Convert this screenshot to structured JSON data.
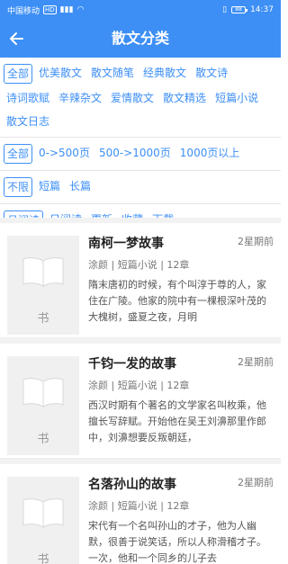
{
  "status": {
    "carrier": "中国移动",
    "hd": "HD",
    "battery": "88",
    "time": "14:37"
  },
  "appbar": {
    "title": "散文分类"
  },
  "filters": {
    "types": [
      "全部",
      "优美散文",
      "散文随笔",
      "经典散文",
      "散文诗",
      "诗词歌赋",
      "辛辣杂文",
      "爱情散文",
      "散文精选",
      "短篇小说",
      "散文日志"
    ],
    "pages": [
      "全部",
      "0->500页",
      "500->1000页",
      "1000页以上"
    ],
    "length": [
      "不限",
      "短篇",
      "长篇"
    ],
    "sort": [
      "月阅读",
      "日阅读",
      "更新",
      "收藏",
      "下载"
    ]
  },
  "books": [
    {
      "title": "南柯一梦故事",
      "time": "2星期前",
      "meta": "涂颜 | 短篇小说 | 12章",
      "desc": "隋末唐初的时候，有个叫淳于尊的人，家住在广陵。他家的院中有一棵根深叶茂的大槐树，盛夏之夜，月明",
      "cover_text": "书"
    },
    {
      "title": "千钧一发的故事",
      "time": "2星期前",
      "meta": "涂颜 | 短篇小说 | 12章",
      "desc": "西汉时期有个著名的文学家名叫枚乘，他擅长写辞赋。开始他在吴王刘濞那里作郎中，刘濞想要反叛朝廷，",
      "cover_text": "书"
    },
    {
      "title": "名落孙山的故事",
      "time": "2星期前",
      "meta": "涂颜 | 短篇小说 | 12章",
      "desc": "宋代有一个名叫孙山的才子，他为人幽默，很善于说笑话，所以人称滑稽才子。一次，他和一个同乡的儿子去",
      "cover_text": "书"
    }
  ]
}
